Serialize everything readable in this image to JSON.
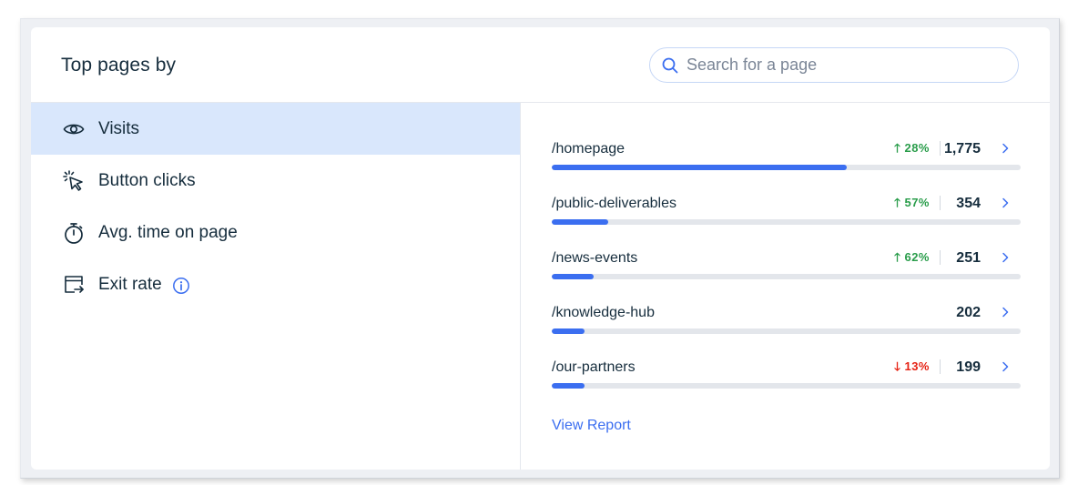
{
  "card": {
    "title": "Top pages by"
  },
  "search": {
    "placeholder": "Search for a page",
    "value": ""
  },
  "sidebar": {
    "items": [
      {
        "label": "Visits",
        "icon": "eye-icon",
        "selected": true
      },
      {
        "label": "Button clicks",
        "icon": "cursor-click-icon",
        "selected": false
      },
      {
        "label": "Avg. time on page",
        "icon": "stopwatch-icon",
        "selected": false
      },
      {
        "label": "Exit rate",
        "icon": "exit-page-icon",
        "selected": false,
        "info_icon": "info-icon"
      }
    ]
  },
  "pages": {
    "rows": [
      {
        "path": "/homepage",
        "change": "28%",
        "direction": "up",
        "count": "1,775",
        "bar_fraction": 0.63
      },
      {
        "path": "/public-deliverables",
        "change": "57%",
        "direction": "up",
        "count": "354",
        "bar_fraction": 0.12
      },
      {
        "path": "/news-events",
        "change": "62%",
        "direction": "up",
        "count": "251",
        "bar_fraction": 0.09
      },
      {
        "path": "/knowledge-hub",
        "change": "",
        "direction": "none",
        "count": "202",
        "bar_fraction": 0.07
      },
      {
        "path": "/our-partners",
        "change": "13%",
        "direction": "down",
        "count": "199",
        "bar_fraction": 0.07
      }
    ],
    "view_report_label": "View Report"
  },
  "colors": {
    "accent": "#3b6ef0",
    "selected_bg": "#d9e7fc",
    "up": "#2a9d4b",
    "down": "#e62214",
    "text": "#162d3d",
    "track": "#e3e6eb"
  }
}
